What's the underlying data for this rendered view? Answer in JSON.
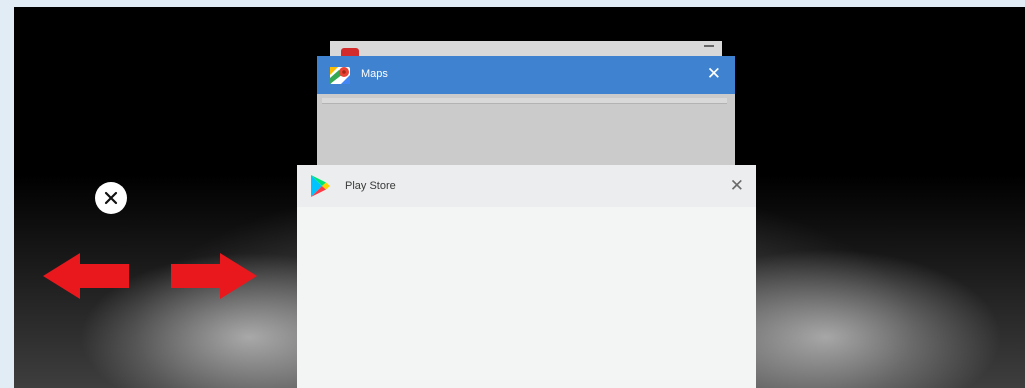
{
  "recents": {
    "back_card": {
      "icon": "youtube-icon"
    },
    "maps_card": {
      "title": "Maps",
      "close_glyph": "✕",
      "icon": "maps-icon",
      "header_color": "#3f83d0"
    },
    "play_card": {
      "title": "Play Store",
      "close_glyph": "✕",
      "icon": "play-store-icon",
      "header_color": "#ebedee"
    }
  },
  "overlay": {
    "dismiss_icon": "close-circle-icon",
    "swipe_hint": [
      "arrow-left-icon",
      "arrow-right-icon"
    ],
    "arrow_color": "#e8181c"
  }
}
